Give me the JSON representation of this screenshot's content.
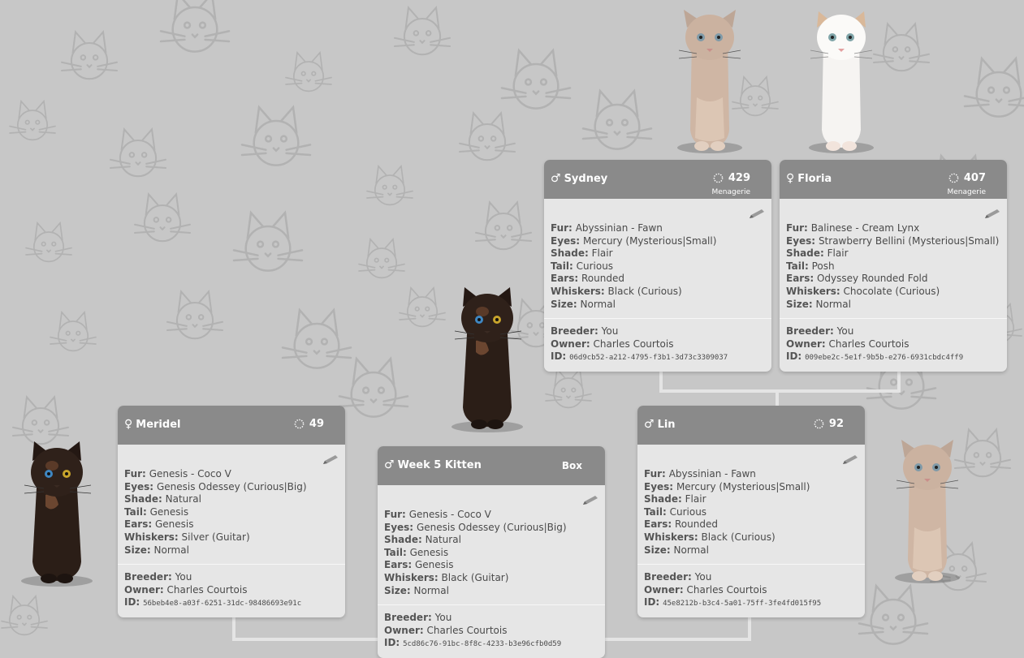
{
  "icons": {
    "gender_male": "♂",
    "gender_female": "♀",
    "stat_icon": "dotted-circle-icon",
    "edit_icon": "pencil-icon",
    "background": "cat-face-pattern"
  },
  "labels": {
    "fur": "Fur:",
    "eyes": "Eyes:",
    "shade": "Shade:",
    "tail": "Tail:",
    "ears": "Ears:",
    "whiskers": "Whiskers:",
    "size": "Size:",
    "breeder": "Breeder:",
    "owner": "Owner:",
    "id": "ID:"
  },
  "colors": {
    "background": "#c7c7c7",
    "card_header": "#8a8a8a",
    "card_body": "#e6e6e6"
  },
  "cards": {
    "sydney": {
      "gender": "♂",
      "name": "Sydney",
      "number": "429",
      "sub": "Menagerie",
      "fur": "Abyssinian - Fawn",
      "eyes": "Mercury (Mysterious|Small)",
      "shade": "Flair",
      "tail": "Curious",
      "ears": "Rounded",
      "whiskers": "Black (Curious)",
      "size": "Normal",
      "breeder": "You",
      "owner": "Charles Courtois",
      "id": "06d9cb52-a212-4795-f3b1-3d73c3309037"
    },
    "floria": {
      "gender": "♀",
      "name": "Floria",
      "number": "407",
      "sub": "Menagerie",
      "fur": "Balinese - Cream Lynx",
      "eyes": "Strawberry Bellini (Mysterious|Small)",
      "shade": "Flair",
      "tail": "Posh",
      "ears": "Odyssey Rounded Fold",
      "whiskers": "Chocolate (Curious)",
      "size": "Normal",
      "breeder": "You",
      "owner": "Charles Courtois",
      "id": "009ebe2c-5e1f-9b5b-e276-6931cbdc4ff9"
    },
    "meridel": {
      "gender": "♀",
      "name": "Meridel",
      "number": "49",
      "fur": "Genesis - Coco V",
      "eyes": "Genesis Odessey (Curious|Big)",
      "shade": "Natural",
      "tail": "Genesis",
      "ears": "Genesis",
      "whiskers": "Silver (Guitar)",
      "size": "Normal",
      "breeder": "You",
      "owner": "Charles Courtois",
      "id": "56beb4e8-a03f-6251-31dc-98486693e91c"
    },
    "kitten": {
      "gender": "♂",
      "name": "Week 5 Kitten",
      "box": "Box",
      "fur": "Genesis - Coco V",
      "eyes": "Genesis Odessey (Curious|Big)",
      "shade": "Natural",
      "tail": "Genesis",
      "ears": "Genesis",
      "whiskers": "Black (Guitar)",
      "size": "Normal",
      "breeder": "You",
      "owner": "Charles Courtois",
      "id": "5cd86c76-91bc-8f8c-4233-b3e96cfb0d59"
    },
    "lin": {
      "gender": "♂",
      "name": "Lin",
      "number": "92",
      "fur": "Abyssinian - Fawn",
      "eyes": "Mercury (Mysterious|Small)",
      "shade": "Flair",
      "tail": "Curious",
      "ears": "Rounded",
      "whiskers": "Black (Curious)",
      "size": "Normal",
      "breeder": "You",
      "owner": "Charles Courtois",
      "id": "45e8212b-b3c4-5a01-75ff-3fe4fd015f95"
    }
  }
}
